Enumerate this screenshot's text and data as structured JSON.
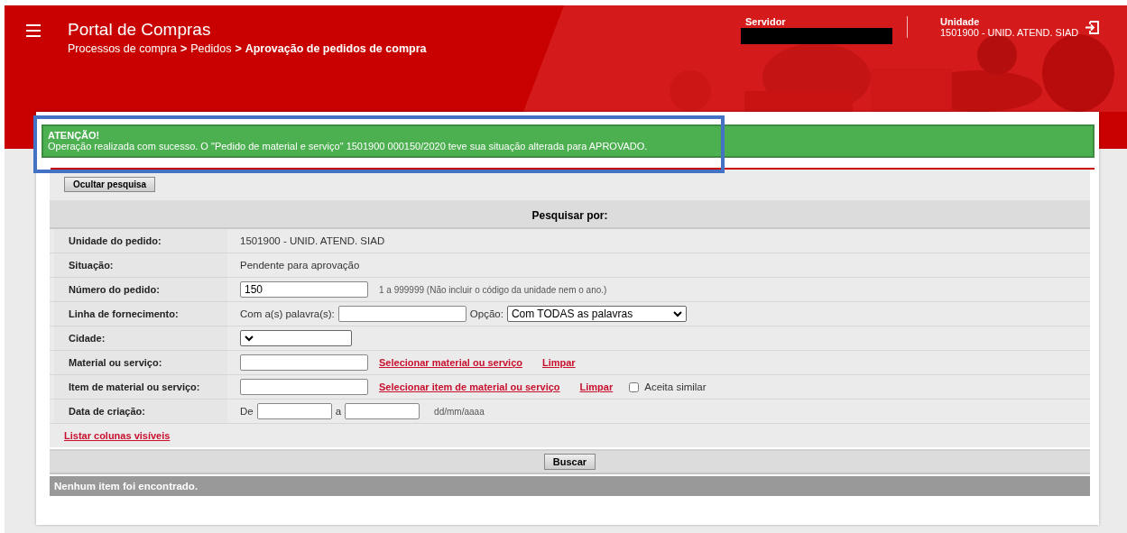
{
  "header": {
    "title": "Portal de Compras",
    "breadcrumb": [
      {
        "label": "Processos de compra",
        "current": false
      },
      {
        "label": "Pedidos",
        "current": false
      },
      {
        "label": "Aprovação de pedidos de compra",
        "current": true
      }
    ],
    "separator": ">",
    "servidor": {
      "label": "Servidor",
      "redacted": true
    },
    "unidade": {
      "label": "Unidade",
      "value": "1501900 - UNID. ATEND. SIAD"
    }
  },
  "alert": {
    "title": "ATENÇÃO!",
    "message": "Operação realizada com sucesso. O \"Pedido de material e serviço\" 1501900 000150/2020 teve sua situação alterada para APROVADO.",
    "highlighted": true
  },
  "toggle_button": "Ocultar pesquisa",
  "search": {
    "heading": "Pesquisar por:",
    "rows": [
      {
        "label": "Unidade do pedido:",
        "kind": "text",
        "value": "1501900 - UNID. ATEND. SIAD"
      },
      {
        "label": "Situação:",
        "kind": "text",
        "value": "Pendente para aprovação"
      },
      {
        "label": "Número do pedido:",
        "kind": "input",
        "value": "150",
        "hint": "1 a 999999 (Não incluir o código da unidade nem o ano.)"
      },
      {
        "label": "Linha de fornecimento:",
        "kind": "keyword",
        "prefix": "Com a(s) palavra(s):",
        "option_label": "Opção:",
        "option_value": "Com TODAS as palavras"
      },
      {
        "label": "Cidade:",
        "kind": "select"
      },
      {
        "label": "Material ou serviço:",
        "kind": "lookup",
        "links": [
          "Selecionar material ou serviço",
          "Limpar"
        ]
      },
      {
        "label": "Item de material ou serviço:",
        "kind": "lookup",
        "links": [
          "Selecionar item de material ou serviço",
          "Limpar"
        ],
        "checkbox": {
          "label": "Aceita similar",
          "checked": false
        }
      },
      {
        "label": "Data de criação:",
        "kind": "date_range",
        "from_label": "De",
        "to_label": "a",
        "hint": "dd/mm/aaaa"
      }
    ],
    "columns_link": "Listar colunas visíveis",
    "button": "Buscar"
  },
  "result": "Nenhum item foi encontrado."
}
